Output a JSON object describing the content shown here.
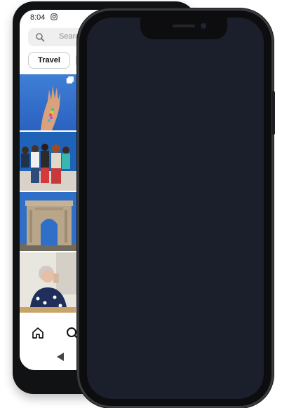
{
  "back_phone": {
    "status": {
      "time": "8:04"
    },
    "search": {
      "placeholder": "Search"
    },
    "chips": [
      {
        "label": "Travel"
      },
      {
        "label": ""
      }
    ],
    "icons": {
      "status": "instagram-icon",
      "search": "search-icon",
      "multi_post": "multiple-posts-icon",
      "home": "home-icon",
      "explore": "search-icon",
      "nav_back": "back-triangle-icon"
    }
  },
  "front_phone": {
    "screen_color": "#1a1f2b"
  }
}
